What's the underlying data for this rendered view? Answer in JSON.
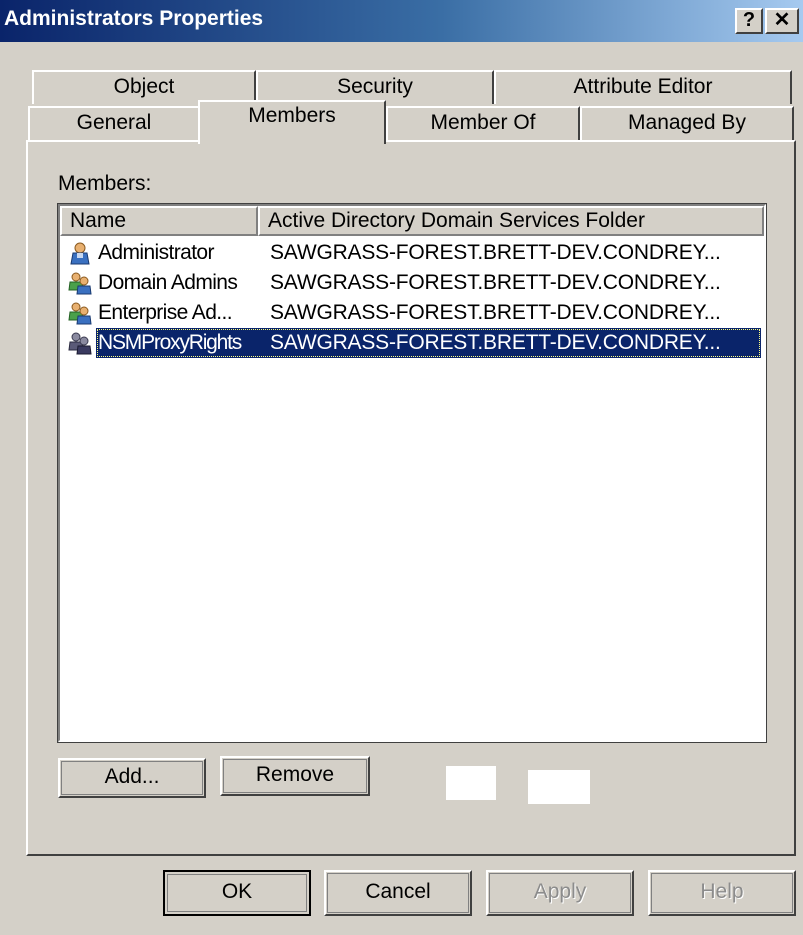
{
  "window": {
    "title": "Administrators Properties",
    "help_button": "?",
    "close_button": "✕"
  },
  "tabs": {
    "top_row": [
      "Object",
      "Security",
      "Attribute Editor"
    ],
    "bottom_row": [
      "General",
      "Members",
      "Member Of",
      "Managed By"
    ],
    "selected": "Members"
  },
  "members": {
    "label": "Members:",
    "columns": [
      "Name",
      "Active Directory Domain Services Folder"
    ],
    "rows": [
      {
        "name": "Administrator",
        "folder": "SAWGRASS-FOREST.BRETT-DEV.CONDREY...",
        "icon": "user-icon",
        "selected": false
      },
      {
        "name": "Domain Admins",
        "folder": "SAWGRASS-FOREST.BRETT-DEV.CONDREY...",
        "icon": "group-icon",
        "selected": false
      },
      {
        "name": "Enterprise Ad...",
        "folder": "SAWGRASS-FOREST.BRETT-DEV.CONDREY...",
        "icon": "group-icon",
        "selected": false
      },
      {
        "name": "NSMProxyRights",
        "folder": "SAWGRASS-FOREST.BRETT-DEV.CONDREY...",
        "icon": "group-icon",
        "selected": true
      }
    ]
  },
  "actions": {
    "add": "Add...",
    "remove": "Remove"
  },
  "dialog_buttons": {
    "ok": "OK",
    "cancel": "Cancel",
    "apply": "Apply",
    "help": "Help"
  },
  "colors": {
    "selection": "#0a246a",
    "title_gradient_start": "#0a246a",
    "title_gradient_end": "#a6caf0",
    "face": "#d4d0c8"
  }
}
